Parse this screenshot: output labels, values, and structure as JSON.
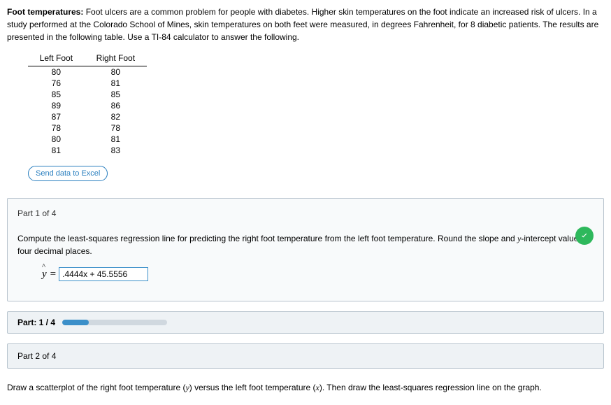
{
  "intro": {
    "bold_label": "Foot temperatures:",
    "text": " Foot ulcers are a common problem for people with diabetes. Higher skin temperatures on the foot indicate an increased risk of ulcers. In a study performed at the Colorado School of Mines, skin temperatures on both feet were measured, in degrees Fahrenheit, for 8 diabetic patients. The results are presented in the following table. Use a TI-84 calculator to answer the following."
  },
  "table": {
    "headers": [
      "Left Foot",
      "Right Foot"
    ],
    "rows": [
      [
        "80",
        "80"
      ],
      [
        "76",
        "81"
      ],
      [
        "85",
        "85"
      ],
      [
        "89",
        "86"
      ],
      [
        "87",
        "82"
      ],
      [
        "78",
        "78"
      ],
      [
        "80",
        "81"
      ],
      [
        "81",
        "83"
      ]
    ]
  },
  "buttons": {
    "excel": "Send data to Excel"
  },
  "part1": {
    "header": "Part 1 of 4",
    "prompt_a": "Compute the least-squares regression line for predicting the right foot temperature from the left foot temperature. Round the slope and ",
    "prompt_yint": "y",
    "prompt_b": "-intercept values to four decimal places.",
    "yhat": "y",
    "eq": "=",
    "answer": ".4444x + 45.5556"
  },
  "progress": {
    "label": "Part: 1 / 4"
  },
  "part2": {
    "header": "Part 2 of 4",
    "prompt_a": "Draw a scatterplot of the right foot temperature (",
    "y": "y",
    "prompt_b": ") versus the left foot temperature (",
    "x": "x",
    "prompt_c": "). Then draw the least-squares regression line on the graph."
  }
}
